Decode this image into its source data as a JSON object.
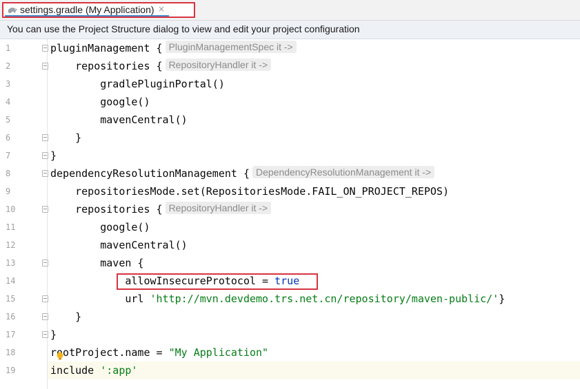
{
  "tab": {
    "label": "settings.gradle (My Application)",
    "close_glyph": "×",
    "icon": "gradle-elephant-icon"
  },
  "banner": {
    "text": "You can use the Project Structure dialog to view and edit your project configuration"
  },
  "editor": {
    "lines": [
      {
        "num": "1",
        "code": "pluginManagement {",
        "hint": "PluginManagementSpec it ->"
      },
      {
        "num": "2",
        "code": "    repositories {",
        "hint": "RepositoryHandler it ->"
      },
      {
        "num": "3",
        "code": "        gradlePluginPortal()"
      },
      {
        "num": "4",
        "code": "        google()"
      },
      {
        "num": "5",
        "code": "        mavenCentral()"
      },
      {
        "num": "6",
        "code": "    }"
      },
      {
        "num": "7",
        "code": "}"
      },
      {
        "num": "8",
        "code": "dependencyResolutionManagement {",
        "hint": "DependencyResolutionManagement it ->"
      },
      {
        "num": "9",
        "code": "    repositoriesMode.set(RepositoriesMode.FAIL_ON_PROJECT_REPOS)"
      },
      {
        "num": "10",
        "code": "    repositories {",
        "hint": "RepositoryHandler it ->"
      },
      {
        "num": "11",
        "code": "        google()"
      },
      {
        "num": "12",
        "code": "        mavenCentral()"
      },
      {
        "num": "13",
        "code": "        maven {"
      },
      {
        "num": "14",
        "code_pre": "            allowInsecureProtocol = ",
        "code_kw": "true"
      },
      {
        "num": "15",
        "code_pre": "            url ",
        "code_str": "'http://mvn.devdemo.trs.net.cn/repository/maven-public/'",
        "code_post": "}"
      },
      {
        "num": "16",
        "code": "    }"
      },
      {
        "num": "17",
        "code": "}"
      },
      {
        "num": "18",
        "code_pre": "rootProject.name = ",
        "code_str": "\"My Application\""
      },
      {
        "num": "19",
        "code_pre": "include ",
        "code_str": "':app'"
      }
    ]
  },
  "colors": {
    "highlight_box": "#d63340",
    "keyword": "#0033b3",
    "string": "#067d17",
    "hint_bg": "#ededed"
  }
}
